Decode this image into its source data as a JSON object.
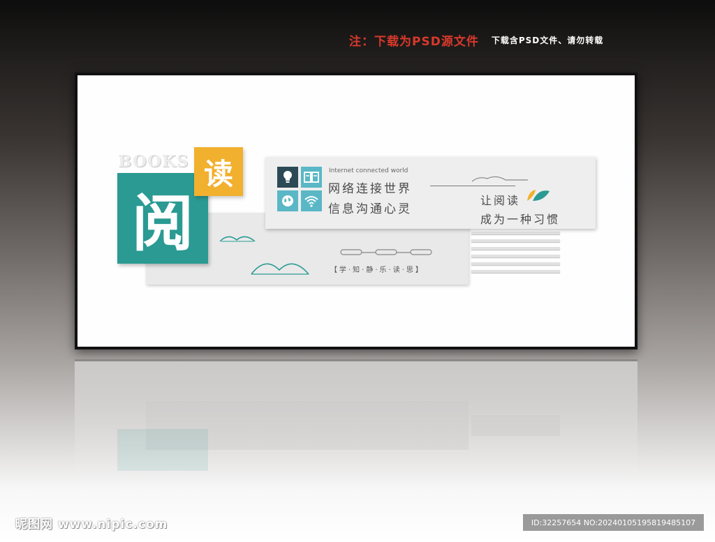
{
  "header_note": {
    "primary": "注：下载为PSD源文件",
    "secondary": "下载含PSD文件、请勿转载"
  },
  "design": {
    "books_label": "BOOKS",
    "teal_char": "阅",
    "yellow_char": "读",
    "internet_label": "Internet connected world",
    "slogan_line1": "网络连接世界",
    "slogan_line2": "信息沟通心灵",
    "slogan_line3": "让阅读",
    "slogan_line4": "成为一种习惯",
    "motto": "【学·知·静·乐·读·思】",
    "icons": [
      "lightbulb-icon",
      "book-icon",
      "globe-icon",
      "wifi-icon"
    ]
  },
  "colors": {
    "teal": "#2a9a93",
    "yellow": "#f1b02e",
    "icon_dark": "#2c4a56",
    "icon_light": "#59b7c6",
    "note_red": "#d8392b"
  },
  "watermark": {
    "site": "昵图网 www.nipic.com",
    "id_text": "ID:32257654 NO:20240105195819485107"
  }
}
